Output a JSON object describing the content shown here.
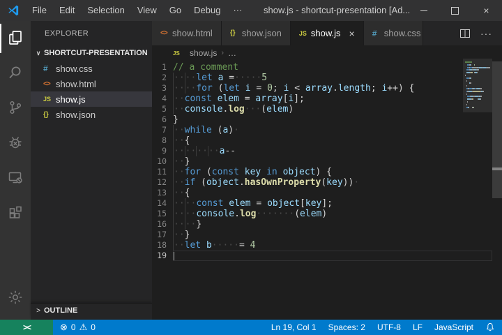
{
  "titlebar": {
    "menus": [
      {
        "name": "file",
        "label": "File"
      },
      {
        "name": "edit",
        "label": "Edit"
      },
      {
        "name": "selection",
        "label": "Selection"
      },
      {
        "name": "view",
        "label": "View"
      },
      {
        "name": "go",
        "label": "Go"
      },
      {
        "name": "debug",
        "label": "Debug"
      },
      {
        "name": "more",
        "label": "···"
      }
    ],
    "title": "show.js - shortcut-presentation [Ad...",
    "controls": {
      "minimize": "minimize",
      "maximize": "maximize",
      "close": "×"
    }
  },
  "activity_bar": {
    "items": [
      "explorer",
      "search",
      "source-control",
      "debug",
      "remote",
      "extensions"
    ],
    "active": "explorer",
    "bottom": "settings"
  },
  "sidebar": {
    "header": "EXPLORER",
    "section": {
      "chevron": "∨",
      "label": "SHORTCUT-PRESENTATION"
    },
    "files": [
      {
        "icon": "#",
        "icon_class": "fi-css",
        "icon_name": "css-file-icon",
        "label": "show.css",
        "selected": false
      },
      {
        "icon": "<>",
        "icon_class": "fi-html",
        "icon_name": "html-file-icon",
        "label": "show.html",
        "selected": false
      },
      {
        "icon": "JS",
        "icon_class": "fi-js",
        "icon_name": "js-file-icon",
        "label": "show.js",
        "selected": true
      },
      {
        "icon": "{}",
        "icon_class": "fi-json",
        "icon_name": "json-file-icon",
        "label": "show.json",
        "selected": false
      }
    ],
    "outline": {
      "chevron": ">",
      "label": "OUTLINE"
    }
  },
  "tabs": [
    {
      "icon": "<>",
      "icon_class": "fi-html",
      "icon_name": "html-file-icon",
      "label": "show.html",
      "active": false,
      "clipped": false
    },
    {
      "icon": "{}",
      "icon_class": "fi-json",
      "icon_name": "json-file-icon",
      "label": "show.json",
      "active": false,
      "clipped": false
    },
    {
      "icon": "JS",
      "icon_class": "fi-js",
      "icon_name": "js-file-icon",
      "label": "show.js",
      "active": true,
      "close": "×",
      "clipped": false
    },
    {
      "icon": "#",
      "icon_class": "fi-css",
      "icon_name": "css-file-icon",
      "label": "show.css",
      "active": false,
      "clipped": true
    }
  ],
  "tab_actions": {
    "more_label": "···"
  },
  "breadcrumb": {
    "file_icon": "JS",
    "file": "show.js",
    "separator": "›",
    "more": "…"
  },
  "editor": {
    "current_line": 19,
    "lines": [
      [
        [
          "com",
          "// a comment"
        ]
      ],
      [
        [
          "g"
        ],
        [
          "ws",
          "··"
        ],
        [
          "g"
        ],
        [
          "ws",
          "··"
        ],
        [
          "kw",
          "let"
        ],
        [
          "pn",
          " "
        ],
        [
          "vr",
          "a"
        ],
        [
          "pn",
          " ="
        ],
        [
          "ws",
          "·····"
        ],
        [
          "nu",
          "5"
        ]
      ],
      [
        [
          "g"
        ],
        [
          "ws",
          "··"
        ],
        [
          "g"
        ],
        [
          "ws",
          "··"
        ],
        [
          "kw",
          "for"
        ],
        [
          "pn",
          " ("
        ],
        [
          "kw",
          "let"
        ],
        [
          "pn",
          " "
        ],
        [
          "vr",
          "i"
        ],
        [
          "pn",
          " = "
        ],
        [
          "nu",
          "0"
        ],
        [
          "pn",
          "; "
        ],
        [
          "vr",
          "i"
        ],
        [
          "pn",
          " < "
        ],
        [
          "vr",
          "array"
        ],
        [
          "pn",
          "."
        ],
        [
          "vr",
          "length"
        ],
        [
          "pn",
          "; "
        ],
        [
          "vr",
          "i"
        ],
        [
          "pn",
          "++) {"
        ]
      ],
      [
        [
          "g"
        ],
        [
          "ws",
          "··"
        ],
        [
          "kw",
          "const"
        ],
        [
          "pn",
          " "
        ],
        [
          "vr",
          "elem"
        ],
        [
          "pn",
          " = "
        ],
        [
          "vr",
          "array"
        ],
        [
          "pn",
          "["
        ],
        [
          "vr",
          "i"
        ],
        [
          "pn",
          "];"
        ]
      ],
      [
        [
          "g"
        ],
        [
          "ws",
          "··"
        ],
        [
          "vr",
          "console"
        ],
        [
          "pn",
          "."
        ],
        [
          "fn",
          "log"
        ],
        [
          "ws",
          "···"
        ],
        [
          "pn",
          "("
        ],
        [
          "vr",
          "elem"
        ],
        [
          "pn",
          ")"
        ]
      ],
      [
        [
          "pn",
          "}"
        ]
      ],
      [
        [
          "g"
        ],
        [
          "ws",
          "··"
        ],
        [
          "kw",
          "while"
        ],
        [
          "pn",
          " ("
        ],
        [
          "vr",
          "a"
        ],
        [
          "pn",
          ")"
        ],
        [
          "ws",
          "·"
        ]
      ],
      [
        [
          "g"
        ],
        [
          "ws",
          "··"
        ],
        [
          "pn",
          "{"
        ]
      ],
      [
        [
          "g"
        ],
        [
          "ws",
          "··"
        ],
        [
          "g"
        ],
        [
          "ws",
          "··"
        ],
        [
          "g"
        ],
        [
          "ws",
          "··"
        ],
        [
          "g"
        ],
        [
          "ws",
          "··"
        ],
        [
          "vr",
          "a"
        ],
        [
          "pn",
          "--"
        ]
      ],
      [
        [
          "g"
        ],
        [
          "ws",
          "··"
        ],
        [
          "pn",
          "}"
        ]
      ],
      [
        [
          "g"
        ],
        [
          "ws",
          "··"
        ],
        [
          "kw",
          "for"
        ],
        [
          "pn",
          " ("
        ],
        [
          "kw",
          "const"
        ],
        [
          "pn",
          " "
        ],
        [
          "vr",
          "key"
        ],
        [
          "pn",
          " "
        ],
        [
          "kw",
          "in"
        ],
        [
          "pn",
          " "
        ],
        [
          "vr",
          "object"
        ],
        [
          "pn",
          ") {"
        ]
      ],
      [
        [
          "g"
        ],
        [
          "ws",
          "··"
        ],
        [
          "kw",
          "if"
        ],
        [
          "pn",
          " ("
        ],
        [
          "vr",
          "object"
        ],
        [
          "pn",
          "."
        ],
        [
          "fn",
          "hasOwnProperty"
        ],
        [
          "pn",
          "("
        ],
        [
          "vr",
          "key"
        ],
        [
          "pn",
          "))"
        ],
        [
          "ws",
          "·"
        ]
      ],
      [
        [
          "g"
        ],
        [
          "ws",
          "··"
        ],
        [
          "pn",
          "{"
        ]
      ],
      [
        [
          "g"
        ],
        [
          "ws",
          "··"
        ],
        [
          "g"
        ],
        [
          "ws",
          "··"
        ],
        [
          "kw",
          "const"
        ],
        [
          "pn",
          " "
        ],
        [
          "vr",
          "elem"
        ],
        [
          "pn",
          " = "
        ],
        [
          "vr",
          "object"
        ],
        [
          "pn",
          "["
        ],
        [
          "vr",
          "key"
        ],
        [
          "pn",
          "];"
        ]
      ],
      [
        [
          "g"
        ],
        [
          "ws",
          "··"
        ],
        [
          "g"
        ],
        [
          "ws",
          "··"
        ],
        [
          "vr",
          "console"
        ],
        [
          "pn",
          "."
        ],
        [
          "fn",
          "log"
        ],
        [
          "ws",
          "·······"
        ],
        [
          "pn",
          "("
        ],
        [
          "vr",
          "elem"
        ],
        [
          "pn",
          ")"
        ]
      ],
      [
        [
          "g"
        ],
        [
          "ws",
          "··"
        ],
        [
          "g"
        ],
        [
          "ws",
          "··"
        ],
        [
          "pn",
          "}"
        ]
      ],
      [
        [
          "g"
        ],
        [
          "ws",
          "··"
        ],
        [
          "pn",
          "}"
        ]
      ],
      [
        [
          "g"
        ],
        [
          "ws",
          "··"
        ],
        [
          "kw",
          "let"
        ],
        [
          "pn",
          " "
        ],
        [
          "vr",
          "b"
        ],
        [
          "ws",
          "·····"
        ],
        [
          "pn",
          "= "
        ],
        [
          "nu",
          "4"
        ]
      ],
      []
    ]
  },
  "status_bar": {
    "remote_icon_label": "><",
    "errors": {
      "icon": "⊗",
      "count": "0"
    },
    "warnings": {
      "icon": "⚠",
      "count": "0"
    },
    "right": [
      {
        "name": "cursor-position",
        "label": "Ln 19, Col 1"
      },
      {
        "name": "indentation",
        "label": "Spaces: 2"
      },
      {
        "name": "encoding",
        "label": "UTF-8"
      },
      {
        "name": "eol",
        "label": "LF"
      },
      {
        "name": "language-mode",
        "label": "JavaScript"
      }
    ]
  },
  "colors": {
    "titlebar_bg": "#323233",
    "activitybar_bg": "#333333",
    "sidebar_bg": "#252526",
    "editor_bg": "#1e1e1e",
    "tab_inactive_bg": "#2d2d2d",
    "statusbar_bg": "#007acc",
    "remote_bg": "#16825d",
    "selection_row": "#37373d",
    "keyword": "#569cd6",
    "variable": "#9cdcfe",
    "number": "#b5cea8",
    "function": "#dcdcaa",
    "comment": "#6a9955",
    "punctuation": "#d4d4d4",
    "whitespace_dot": "#4a4a4a",
    "line_number": "#858585",
    "css_icon": "#519aba",
    "html_icon": "#e37933",
    "js_icon": "#cbcb41",
    "json_icon": "#cbcb41",
    "logo_blue": "#1f9cf0"
  }
}
